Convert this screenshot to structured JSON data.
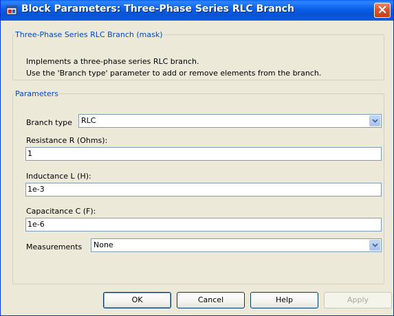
{
  "window": {
    "title": "Block Parameters: Three-Phase Series RLC Branch"
  },
  "mask": {
    "legend": "Three-Phase Series RLC Branch (mask)",
    "description_line1": "Implements a three-phase series RLC branch.",
    "description_line2": "Use the 'Branch type' parameter to add or remove elements from the branch."
  },
  "parameters": {
    "legend": "Parameters",
    "branch_type": {
      "label": "Branch type",
      "value": "RLC"
    },
    "resistance": {
      "label": "Resistance R (Ohms):",
      "value": "1"
    },
    "inductance": {
      "label": "Inductance L (H):",
      "value": "1e-3"
    },
    "capacitance": {
      "label": "Capacitance C (F):",
      "value": "1e-6"
    },
    "measurements": {
      "label": "Measurements",
      "value": "None"
    }
  },
  "buttons": {
    "ok": "OK",
    "cancel": "Cancel",
    "help": "Help",
    "apply": "Apply"
  },
  "colors": {
    "titlebar": "#0a5fe8",
    "group_label": "#0046d5",
    "close_button": "#e0552e",
    "dialog_background": "#ece9d8"
  },
  "icons": {
    "app": "block-parameters-icon",
    "close": "close-icon",
    "dropdown": "chevron-down-icon"
  }
}
